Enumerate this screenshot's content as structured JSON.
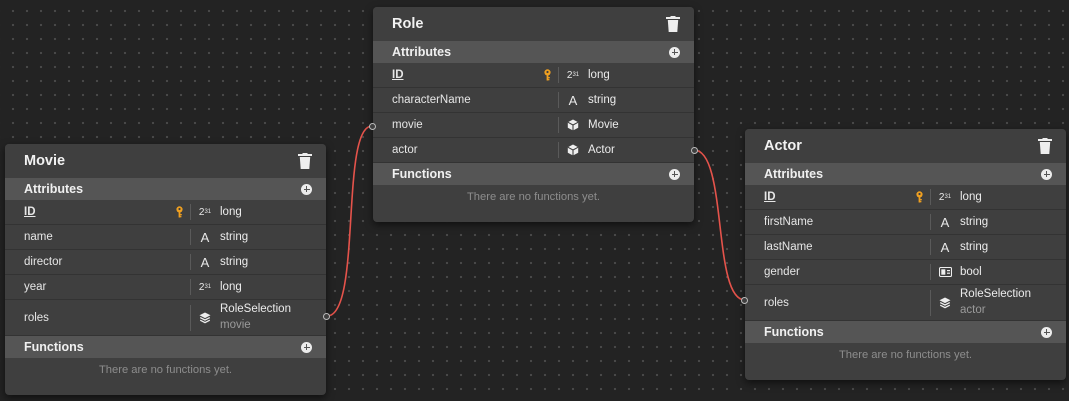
{
  "colors": {
    "connection": "#e5534b",
    "canvas": "#232323",
    "card": "#3f3f3f",
    "section": "#555555",
    "key": "#f0a020"
  },
  "entities": {
    "role": {
      "title": "Role",
      "attributes_label": "Attributes",
      "functions_label": "Functions",
      "no_functions": "There are no functions yet.",
      "attributes": [
        {
          "name": "ID",
          "type": "long",
          "icon": "number-icon",
          "primary": true
        },
        {
          "name": "characterName",
          "type": "string",
          "icon": "text-icon"
        },
        {
          "name": "movie",
          "type": "Movie",
          "icon": "cube-icon"
        },
        {
          "name": "actor",
          "type": "Actor",
          "icon": "cube-icon"
        }
      ]
    },
    "movie": {
      "title": "Movie",
      "attributes_label": "Attributes",
      "functions_label": "Functions",
      "no_functions": "There are no functions yet.",
      "attributes": [
        {
          "name": "ID",
          "type": "long",
          "icon": "number-icon",
          "primary": true
        },
        {
          "name": "name",
          "type": "string",
          "icon": "text-icon"
        },
        {
          "name": "director",
          "type": "string",
          "icon": "text-icon"
        },
        {
          "name": "year",
          "type": "long",
          "icon": "number-icon"
        },
        {
          "name": "roles",
          "type": "RoleSelection",
          "sub": "movie",
          "icon": "layers-icon"
        }
      ]
    },
    "actor": {
      "title": "Actor",
      "attributes_label": "Attributes",
      "functions_label": "Functions",
      "no_functions": "There are no functions yet.",
      "attributes": [
        {
          "name": "ID",
          "type": "long",
          "icon": "number-icon",
          "primary": true
        },
        {
          "name": "firstName",
          "type": "string",
          "icon": "text-icon"
        },
        {
          "name": "lastName",
          "type": "string",
          "icon": "text-icon"
        },
        {
          "name": "gender",
          "type": "bool",
          "icon": "toggle-icon"
        },
        {
          "name": "roles",
          "type": "RoleSelection",
          "sub": "actor",
          "icon": "layers-icon"
        }
      ]
    }
  },
  "icons": {
    "number_glyph": "2",
    "number_sup": "31",
    "text_glyph": "A"
  }
}
